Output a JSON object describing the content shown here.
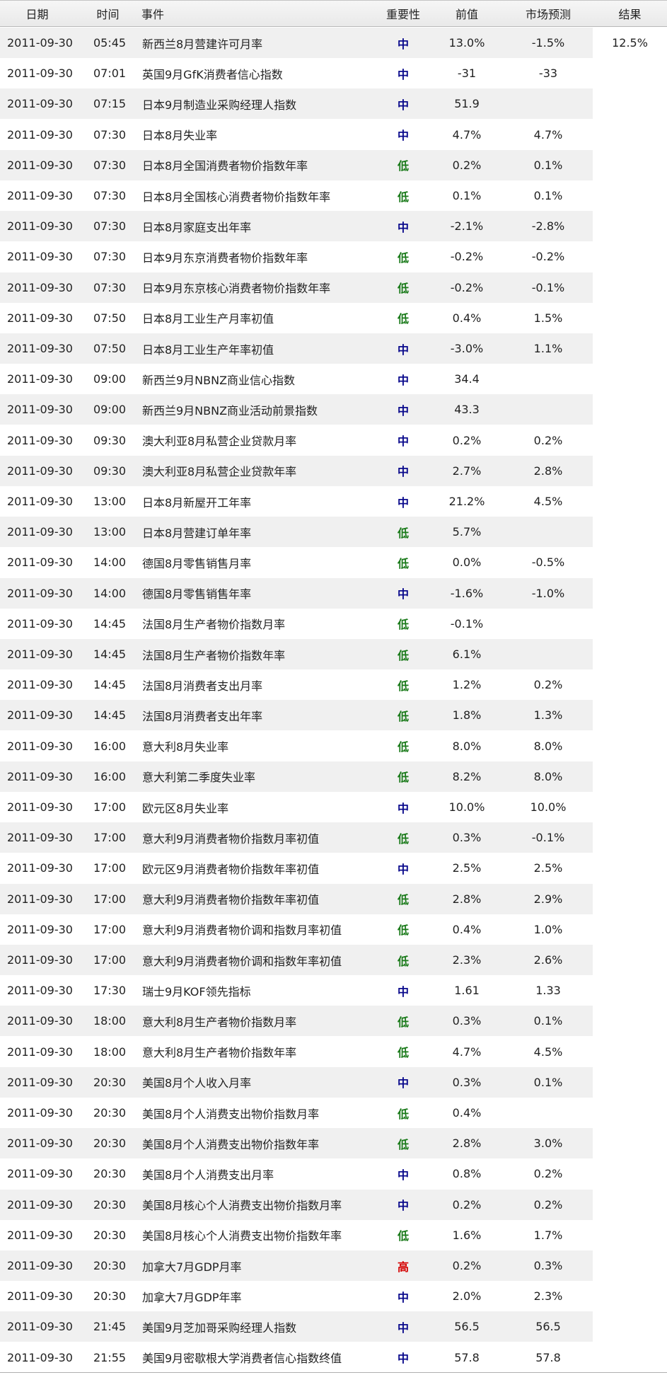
{
  "header": {
    "date": "日期",
    "time": "时间",
    "event": "事件",
    "importance": "重要性",
    "previous": "前值",
    "forecast": "市场预测",
    "result": "结果"
  },
  "colors": {
    "中": "#0a0a8c",
    "低": "#1a7a1a",
    "高": "#d40000"
  },
  "rows": [
    {
      "date": "2011-09-30",
      "time": "05:45",
      "event": "新西兰8月营建许可月率",
      "importance": "中",
      "previous": "13.0%",
      "forecast": "-1.5%",
      "result": "12.5%"
    },
    {
      "date": "2011-09-30",
      "time": "07:01",
      "event": "英国9月GfK消费者信心指数",
      "importance": "中",
      "previous": "-31",
      "forecast": "-33",
      "result": ""
    },
    {
      "date": "2011-09-30",
      "time": "07:15",
      "event": "日本9月制造业采购经理人指数",
      "importance": "中",
      "previous": "51.9",
      "forecast": "",
      "result": ""
    },
    {
      "date": "2011-09-30",
      "time": "07:30",
      "event": "日本8月失业率",
      "importance": "中",
      "previous": "4.7%",
      "forecast": "4.7%",
      "result": ""
    },
    {
      "date": "2011-09-30",
      "time": "07:30",
      "event": "日本8月全国消费者物价指数年率",
      "importance": "低",
      "previous": "0.2%",
      "forecast": "0.1%",
      "result": ""
    },
    {
      "date": "2011-09-30",
      "time": "07:30",
      "event": "日本8月全国核心消费者物价指数年率",
      "importance": "低",
      "previous": "0.1%",
      "forecast": "0.1%",
      "result": ""
    },
    {
      "date": "2011-09-30",
      "time": "07:30",
      "event": "日本8月家庭支出年率",
      "importance": "中",
      "previous": "-2.1%",
      "forecast": "-2.8%",
      "result": ""
    },
    {
      "date": "2011-09-30",
      "time": "07:30",
      "event": "日本9月东京消费者物价指数年率",
      "importance": "低",
      "previous": "-0.2%",
      "forecast": "-0.2%",
      "result": ""
    },
    {
      "date": "2011-09-30",
      "time": "07:30",
      "event": "日本9月东京核心消费者物价指数年率",
      "importance": "低",
      "previous": "-0.2%",
      "forecast": "-0.1%",
      "result": ""
    },
    {
      "date": "2011-09-30",
      "time": "07:50",
      "event": "日本8月工业生产月率初值",
      "importance": "低",
      "previous": "0.4%",
      "forecast": "1.5%",
      "result": ""
    },
    {
      "date": "2011-09-30",
      "time": "07:50",
      "event": "日本8月工业生产年率初值",
      "importance": "中",
      "previous": "-3.0%",
      "forecast": "1.1%",
      "result": ""
    },
    {
      "date": "2011-09-30",
      "time": "09:00",
      "event": "新西兰9月NBNZ商业信心指数",
      "importance": "中",
      "previous": "34.4",
      "forecast": "",
      "result": ""
    },
    {
      "date": "2011-09-30",
      "time": "09:00",
      "event": "新西兰9月NBNZ商业活动前景指数",
      "importance": "中",
      "previous": "43.3",
      "forecast": "",
      "result": ""
    },
    {
      "date": "2011-09-30",
      "time": "09:30",
      "event": "澳大利亚8月私营企业贷款月率",
      "importance": "中",
      "previous": "0.2%",
      "forecast": "0.2%",
      "result": ""
    },
    {
      "date": "2011-09-30",
      "time": "09:30",
      "event": "澳大利亚8月私营企业贷款年率",
      "importance": "中",
      "previous": "2.7%",
      "forecast": "2.8%",
      "result": ""
    },
    {
      "date": "2011-09-30",
      "time": "13:00",
      "event": "日本8月新屋开工年率",
      "importance": "中",
      "previous": "21.2%",
      "forecast": "4.5%",
      "result": ""
    },
    {
      "date": "2011-09-30",
      "time": "13:00",
      "event": "日本8月营建订单年率",
      "importance": "低",
      "previous": "5.7%",
      "forecast": "",
      "result": ""
    },
    {
      "date": "2011-09-30",
      "time": "14:00",
      "event": "德国8月零售销售月率",
      "importance": "低",
      "previous": "0.0%",
      "forecast": "-0.5%",
      "result": ""
    },
    {
      "date": "2011-09-30",
      "time": "14:00",
      "event": "德国8月零售销售年率",
      "importance": "中",
      "previous": "-1.6%",
      "forecast": "-1.0%",
      "result": ""
    },
    {
      "date": "2011-09-30",
      "time": "14:45",
      "event": "法国8月生产者物价指数月率",
      "importance": "低",
      "previous": "-0.1%",
      "forecast": "",
      "result": ""
    },
    {
      "date": "2011-09-30",
      "time": "14:45",
      "event": "法国8月生产者物价指数年率",
      "importance": "低",
      "previous": "6.1%",
      "forecast": "",
      "result": ""
    },
    {
      "date": "2011-09-30",
      "time": "14:45",
      "event": "法国8月消费者支出月率",
      "importance": "低",
      "previous": "1.2%",
      "forecast": "0.2%",
      "result": ""
    },
    {
      "date": "2011-09-30",
      "time": "14:45",
      "event": "法国8月消费者支出年率",
      "importance": "低",
      "previous": "1.8%",
      "forecast": "1.3%",
      "result": ""
    },
    {
      "date": "2011-09-30",
      "time": "16:00",
      "event": "意大利8月失业率",
      "importance": "低",
      "previous": "8.0%",
      "forecast": "8.0%",
      "result": ""
    },
    {
      "date": "2011-09-30",
      "time": "16:00",
      "event": "意大利第二季度失业率",
      "importance": "低",
      "previous": "8.2%",
      "forecast": "8.0%",
      "result": ""
    },
    {
      "date": "2011-09-30",
      "time": "17:00",
      "event": "欧元区8月失业率",
      "importance": "中",
      "previous": "10.0%",
      "forecast": "10.0%",
      "result": ""
    },
    {
      "date": "2011-09-30",
      "time": "17:00",
      "event": "意大利9月消费者物价指数月率初值",
      "importance": "低",
      "previous": "0.3%",
      "forecast": "-0.1%",
      "result": ""
    },
    {
      "date": "2011-09-30",
      "time": "17:00",
      "event": "欧元区9月消费者物价指数年率初值",
      "importance": "中",
      "previous": "2.5%",
      "forecast": "2.5%",
      "result": ""
    },
    {
      "date": "2011-09-30",
      "time": "17:00",
      "event": "意大利9月消费者物价指数年率初值",
      "importance": "低",
      "previous": "2.8%",
      "forecast": "2.9%",
      "result": ""
    },
    {
      "date": "2011-09-30",
      "time": "17:00",
      "event": "意大利9月消费者物价调和指数月率初值",
      "importance": "低",
      "previous": "0.4%",
      "forecast": "1.0%",
      "result": ""
    },
    {
      "date": "2011-09-30",
      "time": "17:00",
      "event": "意大利9月消费者物价调和指数年率初值",
      "importance": "低",
      "previous": "2.3%",
      "forecast": "2.6%",
      "result": ""
    },
    {
      "date": "2011-09-30",
      "time": "17:30",
      "event": "瑞士9月KOF领先指标",
      "importance": "中",
      "previous": "1.61",
      "forecast": "1.33",
      "result": ""
    },
    {
      "date": "2011-09-30",
      "time": "18:00",
      "event": "意大利8月生产者物价指数月率",
      "importance": "低",
      "previous": "0.3%",
      "forecast": "0.1%",
      "result": ""
    },
    {
      "date": "2011-09-30",
      "time": "18:00",
      "event": "意大利8月生产者物价指数年率",
      "importance": "低",
      "previous": "4.7%",
      "forecast": "4.5%",
      "result": ""
    },
    {
      "date": "2011-09-30",
      "time": "20:30",
      "event": "美国8月个人收入月率",
      "importance": "中",
      "previous": "0.3%",
      "forecast": "0.1%",
      "result": ""
    },
    {
      "date": "2011-09-30",
      "time": "20:30",
      "event": "美国8月个人消费支出物价指数月率",
      "importance": "低",
      "previous": "0.4%",
      "forecast": "",
      "result": ""
    },
    {
      "date": "2011-09-30",
      "time": "20:30",
      "event": "美国8月个人消费支出物价指数年率",
      "importance": "低",
      "previous": "2.8%",
      "forecast": "3.0%",
      "result": ""
    },
    {
      "date": "2011-09-30",
      "time": "20:30",
      "event": "美国8月个人消费支出月率",
      "importance": "中",
      "previous": "0.8%",
      "forecast": "0.2%",
      "result": ""
    },
    {
      "date": "2011-09-30",
      "time": "20:30",
      "event": "美国8月核心个人消费支出物价指数月率",
      "importance": "中",
      "previous": "0.2%",
      "forecast": "0.2%",
      "result": ""
    },
    {
      "date": "2011-09-30",
      "time": "20:30",
      "event": "美国8月核心个人消费支出物价指数年率",
      "importance": "低",
      "previous": "1.6%",
      "forecast": "1.7%",
      "result": ""
    },
    {
      "date": "2011-09-30",
      "time": "20:30",
      "event": "加拿大7月GDP月率",
      "importance": "高",
      "previous": "0.2%",
      "forecast": "0.3%",
      "result": ""
    },
    {
      "date": "2011-09-30",
      "time": "20:30",
      "event": "加拿大7月GDP年率",
      "importance": "中",
      "previous": "2.0%",
      "forecast": "2.3%",
      "result": ""
    },
    {
      "date": "2011-09-30",
      "time": "21:45",
      "event": "美国9月芝加哥采购经理人指数",
      "importance": "中",
      "previous": "56.5",
      "forecast": "56.5",
      "result": ""
    },
    {
      "date": "2011-09-30",
      "time": "21:55",
      "event": "美国9月密歇根大学消费者信心指数终值",
      "importance": "中",
      "previous": "57.8",
      "forecast": "57.8",
      "result": ""
    }
  ]
}
